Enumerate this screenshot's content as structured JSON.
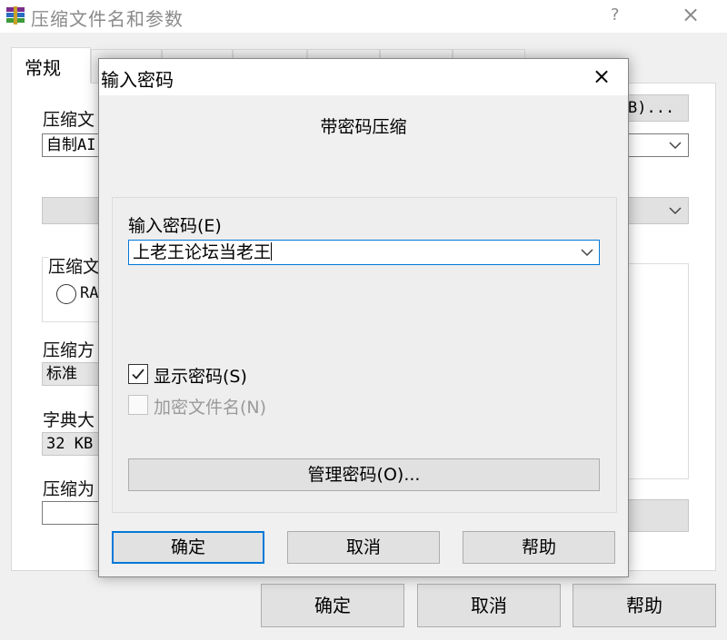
{
  "main_window": {
    "title": "压缩文件名和参数",
    "help_glyph": "?",
    "close_glyph": "×",
    "tabs": [
      {
        "label": "常规"
      }
    ],
    "fields": {
      "archive_name_label": "压缩文",
      "archive_name_value": "自制AI",
      "browse_button_fragment": "B)...",
      "format_label": "压缩文",
      "format_option": "RA",
      "method_label": "压缩方",
      "method_value": "标准",
      "dictionary_label": "字典大",
      "dictionary_value": "32 KB",
      "split_label": "压缩为"
    },
    "buttons": {
      "ok": "确定",
      "cancel": "取消",
      "help": "帮助"
    }
  },
  "dialog": {
    "title": "输入密码",
    "close_glyph": "×",
    "subtitle": "带密码压缩",
    "password_label": "输入密码(E)",
    "password_value": "上老王论坛当老王",
    "show_password": {
      "label": "显示密码(S)",
      "checked": true
    },
    "encrypt_filenames": {
      "label": "加密文件名(N)",
      "checked": false,
      "disabled": true
    },
    "manage_button": "管理密码(O)...",
    "buttons": {
      "ok": "确定",
      "cancel": "取消",
      "help": "帮助"
    }
  },
  "colors": {
    "accent": "#0078d7",
    "button_face": "#e1e1e1",
    "window_bg": "#f0f0f0"
  }
}
